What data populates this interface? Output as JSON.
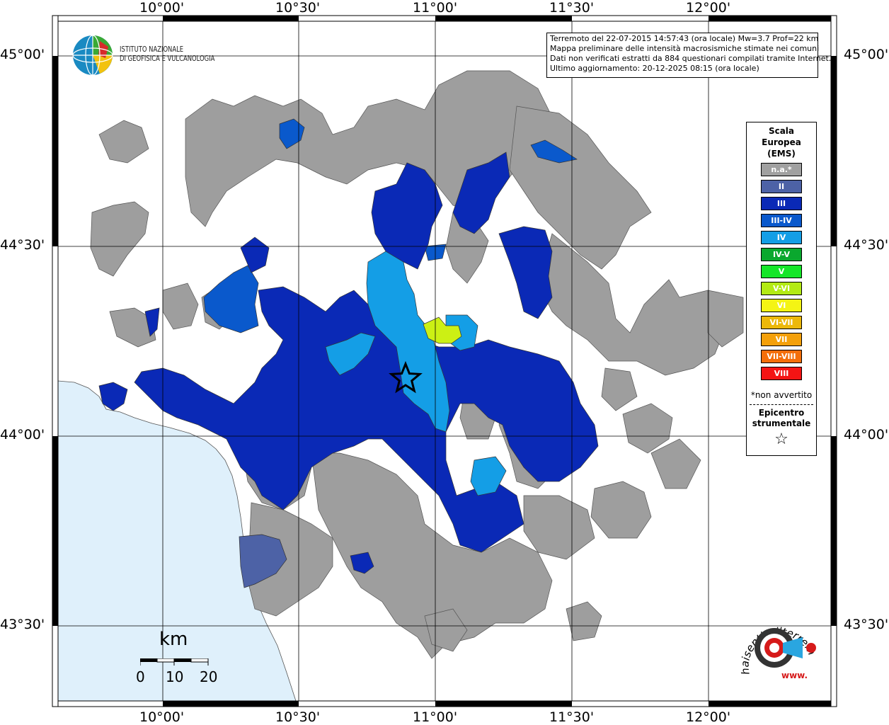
{
  "map": {
    "top_labels": [
      "10°00'",
      "10°30'",
      "11°00'",
      "11°30'",
      "12°00'"
    ],
    "bottom_labels": [
      "10°00'",
      "10°30'",
      "11°00'",
      "11°30'",
      "12°00'"
    ],
    "left_labels": [
      "45°00'",
      "44°30'",
      "44°00'",
      "43°30'"
    ],
    "right_labels": [
      "45°00'",
      "44°30'",
      "44°00'",
      "43°30'"
    ],
    "colors": {
      "sea": "#dff0fb",
      "land": "#ffffff",
      "na": "#9e9e9e",
      "II": "#4d62a6",
      "III": "#0a29b6",
      "III-IV": "#0a59cc",
      "IV": "#149ee6",
      "VI-VII": "#ccf014"
    }
  },
  "info": {
    "line1": "Terremoto del 22-07-2015 14:57:43 (ora locale) Mw=3.7 Prof=22 km",
    "line2": "Mappa preliminare delle intensità macrosismiche stimate nei comuni",
    "line3": "Dati non verificati estratti da 884 questionari compilati tramite Internet.",
    "line4": "Ultimo aggiornamento: 20-12-2025 08:15 (ora locale)"
  },
  "legend": {
    "title1": "Scala",
    "title2": "Europea",
    "title3": "(EMS)",
    "items": [
      {
        "label": "n.a.*",
        "color": "#a0a0a0"
      },
      {
        "label": "II",
        "color": "#4d62a6"
      },
      {
        "label": "III",
        "color": "#0a29b6"
      },
      {
        "label": "III-IV",
        "color": "#0a59cc"
      },
      {
        "label": "IV",
        "color": "#149ee6"
      },
      {
        "label": "IV-V",
        "color": "#0aa82e"
      },
      {
        "label": "V",
        "color": "#14e628"
      },
      {
        "label": "V-VI",
        "color": "#b3ea14"
      },
      {
        "label": "VI",
        "color": "#f4f414"
      },
      {
        "label": "VI-VII",
        "color": "#ecb80a"
      },
      {
        "label": "VII",
        "color": "#f4a00a"
      },
      {
        "label": "VII-VIII",
        "color": "#f46e0a"
      },
      {
        "label": "VIII",
        "color": "#f41414"
      }
    ],
    "note": "*non avvertito",
    "epi1": "Epicentro",
    "epi2": "strumentale",
    "star": "☆"
  },
  "logo": {
    "line1": "ISTITUTO NAZIONALE",
    "line2": "DI GEOFISICA E VULCANOLOGIA"
  },
  "scalebar": {
    "unit": "km",
    "labels": [
      "0",
      "10",
      "20"
    ]
  },
  "badge": {
    "ring_text": "haisentitoilterremoto.it",
    "bottom_text": "www."
  }
}
